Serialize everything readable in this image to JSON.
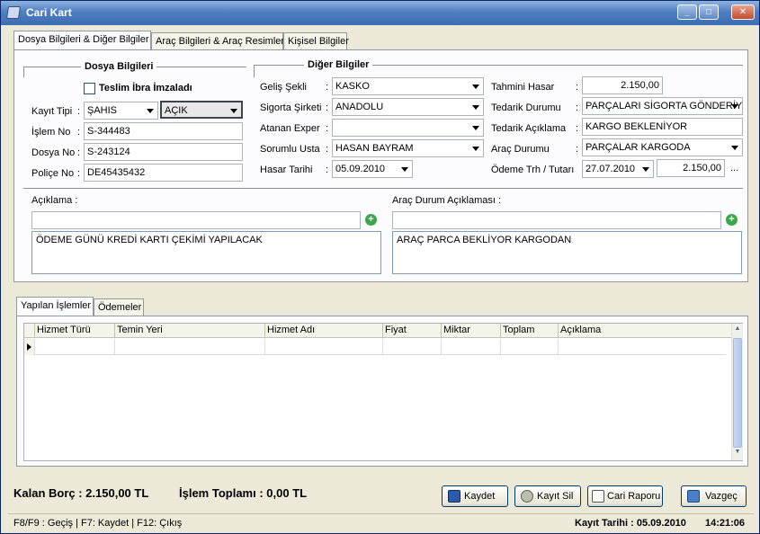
{
  "window": {
    "title": "Cari Kart"
  },
  "tabs": [
    {
      "label": "Dosya Bilgileri & Diğer Bilgiler",
      "active": true
    },
    {
      "label": "Araç Bilgileri & Araç Resimleri",
      "active": false
    },
    {
      "label": "Kişisel Bilgiler",
      "active": false
    }
  ],
  "dosya": {
    "title": "Dosya Bilgileri",
    "teslim_label": "Teslim İbra İmzaladı",
    "teslim_checked": false,
    "kayit_tipi_label": "Kayıt Tipi",
    "kayit_tipi_value": "ŞAHIS",
    "kayit_durum_value": "AÇIK",
    "islem_no_label": "İşlem No",
    "islem_no_value": "S-344483",
    "dosya_no_label": "Dosya No",
    "dosya_no_value": "S-243124",
    "police_no_label": "Poliçe No",
    "police_no_value": "DE45435432"
  },
  "diger": {
    "title": "Diğer Bilgiler",
    "gelis_label": "Geliş Şekli",
    "gelis_value": "KASKO",
    "sigorta_label": "Sigorta Şirketi",
    "sigorta_value": "ANADOLU",
    "exper_label": "Atanan Exper",
    "exper_value": "",
    "usta_label": "Sorumlu Usta",
    "usta_value": "HASAN BAYRAM",
    "hasar_tarihi_label": "Hasar Tarihi",
    "hasar_tarihi_value": "05.09.2010",
    "tahmini_label": "Tahmini Hasar",
    "tahmini_value": "2.150,00",
    "tedarik_durum_label": "Tedarik Durumu",
    "tedarik_durum_value": "PARÇALARI SİGORTA GÖNDERİY",
    "tedarik_aciklama_label": "Tedarik Açıklama",
    "tedarik_aciklama_value": "KARGO BEKLENİYOR",
    "arac_durum_label": "Araç Durumu",
    "arac_durum_value": "PARÇALAR KARGODA",
    "odeme_label": "Ödeme Trh / Tutarı",
    "odeme_tarih_value": "27.07.2010",
    "odeme_tutar_value": "2.150,00",
    "odeme_more": "..."
  },
  "colon": ":",
  "aciklama": {
    "label": "Açıklama :",
    "input_value": "",
    "memo_value": "ÖDEME GÜNÜ KREDİ KARTI ÇEKİMİ YAPILACAK"
  },
  "arac_aciklama": {
    "label": "Araç Durum Açıklaması :",
    "input_value": "",
    "memo_value": "ARAÇ PARCA BEKLİYOR KARGODAN"
  },
  "bottom_tabs": [
    {
      "label": "Yapılan İşlemler",
      "active": true
    },
    {
      "label": "Ödemeler",
      "active": false
    }
  ],
  "grid": {
    "columns": [
      "Hizmet Türü",
      "Temin Yeri",
      "Hizmet Adı",
      "Fiyat",
      "Miktar",
      "Toplam",
      "Açıklama"
    ]
  },
  "summary": {
    "kalan_borc": "Kalan Borç : 2.150,00 TL",
    "islem_toplami": "İşlem Toplamı : 0,00 TL"
  },
  "buttons": {
    "kaydet": "Kaydet",
    "kayit_sil": "Kayıt Sil",
    "cari_raporu": "Cari Raporu",
    "vazgec": "Vazgeç"
  },
  "status": {
    "shortcuts": "F8/F9 : Geçiş | F7: Kaydet | F12: Çıkış",
    "kayit_tarihi": "Kayıt Tarihi : 05.09.2010",
    "time": "14:21:06"
  },
  "colors": {
    "title_bar": "#3c6db3",
    "panel": "#fcfcfe",
    "background": "#ece9d8"
  }
}
